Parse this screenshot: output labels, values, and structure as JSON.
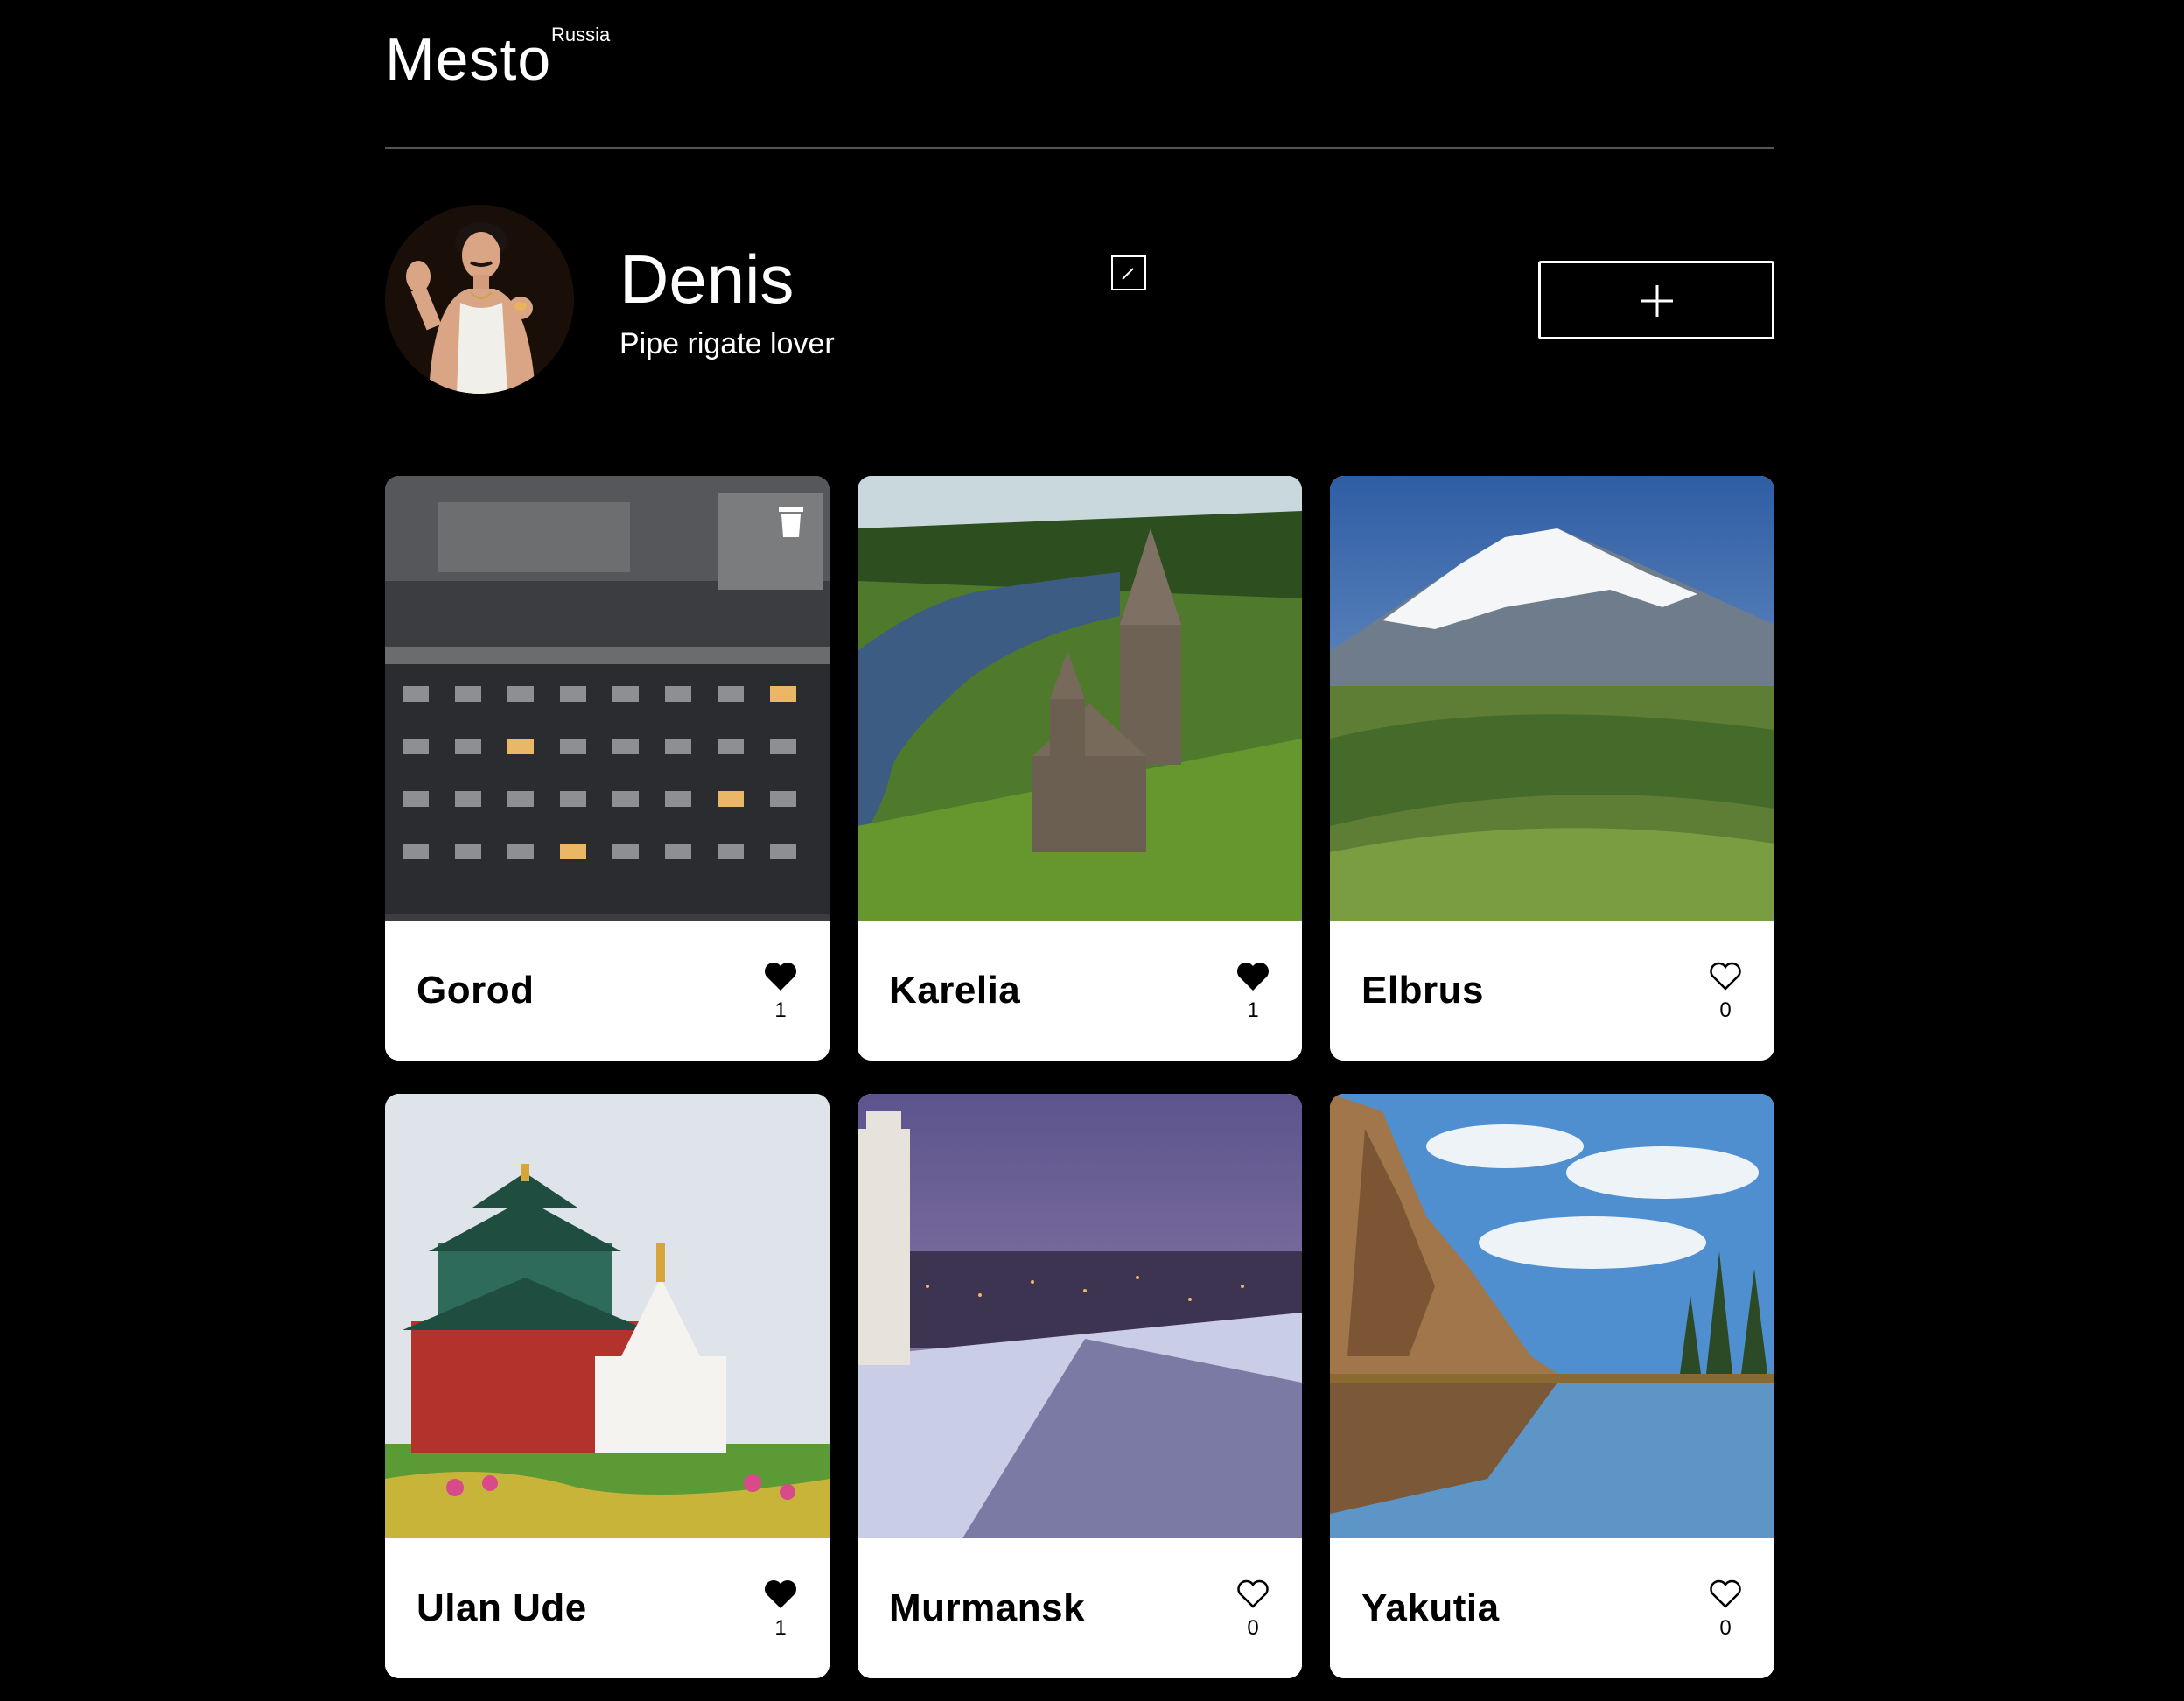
{
  "header": {
    "logo": "Mesto",
    "logo_sup": "Russia"
  },
  "profile": {
    "name": "Denis",
    "about": "Pipe rigate lover",
    "avatar_alt": "avatar"
  },
  "icons": {
    "edit": "pencil-icon",
    "add": "plus-icon",
    "like_active": "heart-filled-icon",
    "like_inactive": "heart-outline-icon",
    "delete": "trash-icon"
  },
  "cards": [
    {
      "title": "Gorod",
      "likes": "1",
      "liked": true,
      "deletable": true
    },
    {
      "title": "Karelia",
      "likes": "1",
      "liked": true,
      "deletable": false
    },
    {
      "title": "Elbrus",
      "likes": "0",
      "liked": false,
      "deletable": false
    },
    {
      "title": "Ulan Ude",
      "likes": "1",
      "liked": true,
      "deletable": false
    },
    {
      "title": "Murmansk",
      "likes": "0",
      "liked": false,
      "deletable": false
    },
    {
      "title": "Yakutia",
      "likes": "0",
      "liked": false,
      "deletable": false
    }
  ],
  "colors": {
    "background": "#000000",
    "card": "#ffffff",
    "divider": "#545454",
    "text": "#ffffff",
    "card_text": "#000000"
  }
}
